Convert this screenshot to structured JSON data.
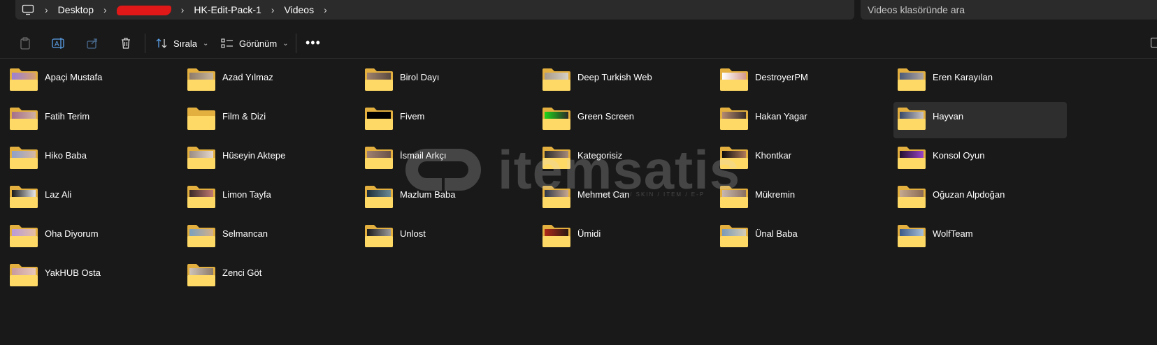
{
  "breadcrumb": {
    "items": [
      "Desktop",
      "",
      "HK-Edit-Pack-1",
      "Videos"
    ],
    "redacted_index": 1
  },
  "search": {
    "placeholder": "Videos klasöründe ara"
  },
  "toolbar": {
    "sort_label": "Sırala",
    "view_label": "Görünüm"
  },
  "watermark": {
    "text": "itemsatis",
    "subtext": "HESAP / SKIN / ITEM / E-P"
  },
  "folders": [
    {
      "name": "Apaçi Mustafa",
      "thumb": [
        "#9b7fd4",
        "#d8a070"
      ]
    },
    {
      "name": "Azad Yılmaz",
      "thumb": [
        "#8d7a6a",
        "#c9b69a"
      ]
    },
    {
      "name": "Birol Dayı",
      "thumb": [
        "#a0826e",
        "#5a4a40"
      ]
    },
    {
      "name": "Deep Turkish Web",
      "thumb": [
        "#a79a8a",
        "#d6cfc4"
      ]
    },
    {
      "name": "DestroyerPM",
      "thumb": [
        "#ffffff",
        "#d49a8c"
      ]
    },
    {
      "name": "Eren Karayılan",
      "thumb": [
        "#4a5a78",
        "#b0a6a0"
      ]
    },
    {
      "name": "Fatih Terim",
      "thumb": [
        "#a56f8a",
        "#d0b0a0"
      ]
    },
    {
      "name": "Film & Dizi",
      "thumb": null
    },
    {
      "name": "Fivem",
      "thumb": [
        "#000000",
        "#000000"
      ]
    },
    {
      "name": "Green Screen",
      "thumb": [
        "#1fd61a",
        "#2a2a2a"
      ]
    },
    {
      "name": "Hakan Yagar",
      "thumb": [
        "#b58a70",
        "#3a2e2a"
      ]
    },
    {
      "name": "Hayvan",
      "thumb": [
        "#384868",
        "#c9c2c0"
      ]
    },
    {
      "name": "Hiko Baba",
      "thumb": [
        "#8fa0c8",
        "#d8b8a0"
      ]
    },
    {
      "name": "Hüseyin Aktepe",
      "thumb": [
        "#9a8c82",
        "#e6d8cc"
      ]
    },
    {
      "name": "İsmail Arkçı",
      "thumb": [
        "#a08070",
        "#6a5248"
      ]
    },
    {
      "name": "Kategorisiz",
      "thumb": [
        "#2a2a2a",
        "#a68a78"
      ]
    },
    {
      "name": "Khontkar",
      "thumb": [
        "#0c0c0c",
        "#b07a58"
      ]
    },
    {
      "name": "Konsol Oyun",
      "thumb": [
        "#24102e",
        "#9a44c8"
      ]
    },
    {
      "name": "Laz Ali",
      "thumb": [
        "#1a1a1a",
        "#e8e8e8"
      ]
    },
    {
      "name": "Limon Tayfa",
      "thumb": [
        "#3a2a28",
        "#c07a70"
      ]
    },
    {
      "name": "Mazlum Baba",
      "thumb": [
        "#1e2e38",
        "#6a8a96"
      ]
    },
    {
      "name": "Mehmet Can",
      "thumb": [
        "#2e3848",
        "#c8a890"
      ]
    },
    {
      "name": "Mükremin",
      "thumb": [
        "#c8b8b0",
        "#8a7060"
      ]
    },
    {
      "name": "Oğuzan Alpdoğan",
      "thumb": [
        "#c4a890",
        "#8a6a52"
      ]
    },
    {
      "name": "Oha Diyorum",
      "thumb": [
        "#b89ad8",
        "#e8c0a0"
      ]
    },
    {
      "name": "Selmancan",
      "thumb": [
        "#7aa0c0",
        "#d4b088"
      ]
    },
    {
      "name": "Unlost",
      "thumb": [
        "#1a1a1a",
        "#9a9a9a"
      ]
    },
    {
      "name": "Ümidi",
      "thumb": [
        "#b02a1a",
        "#2a1a14"
      ]
    },
    {
      "name": "Ünal Baba",
      "thumb": [
        "#7a9ab8",
        "#d6ccb4"
      ]
    },
    {
      "name": "WolfTeam",
      "thumb": [
        "#3a5a88",
        "#a8c0d8"
      ]
    },
    {
      "name": "YakHUB Osta",
      "thumb": [
        "#c89aa0",
        "#e8c8b8"
      ]
    },
    {
      "name": "Zenci Göt",
      "thumb": [
        "#cfc4b8",
        "#8a7a6a"
      ]
    }
  ],
  "selected_folder": "Hayvan",
  "colors": {
    "folder_back": "#e3b040",
    "folder_front": "#ffd966",
    "background": "#191919"
  }
}
